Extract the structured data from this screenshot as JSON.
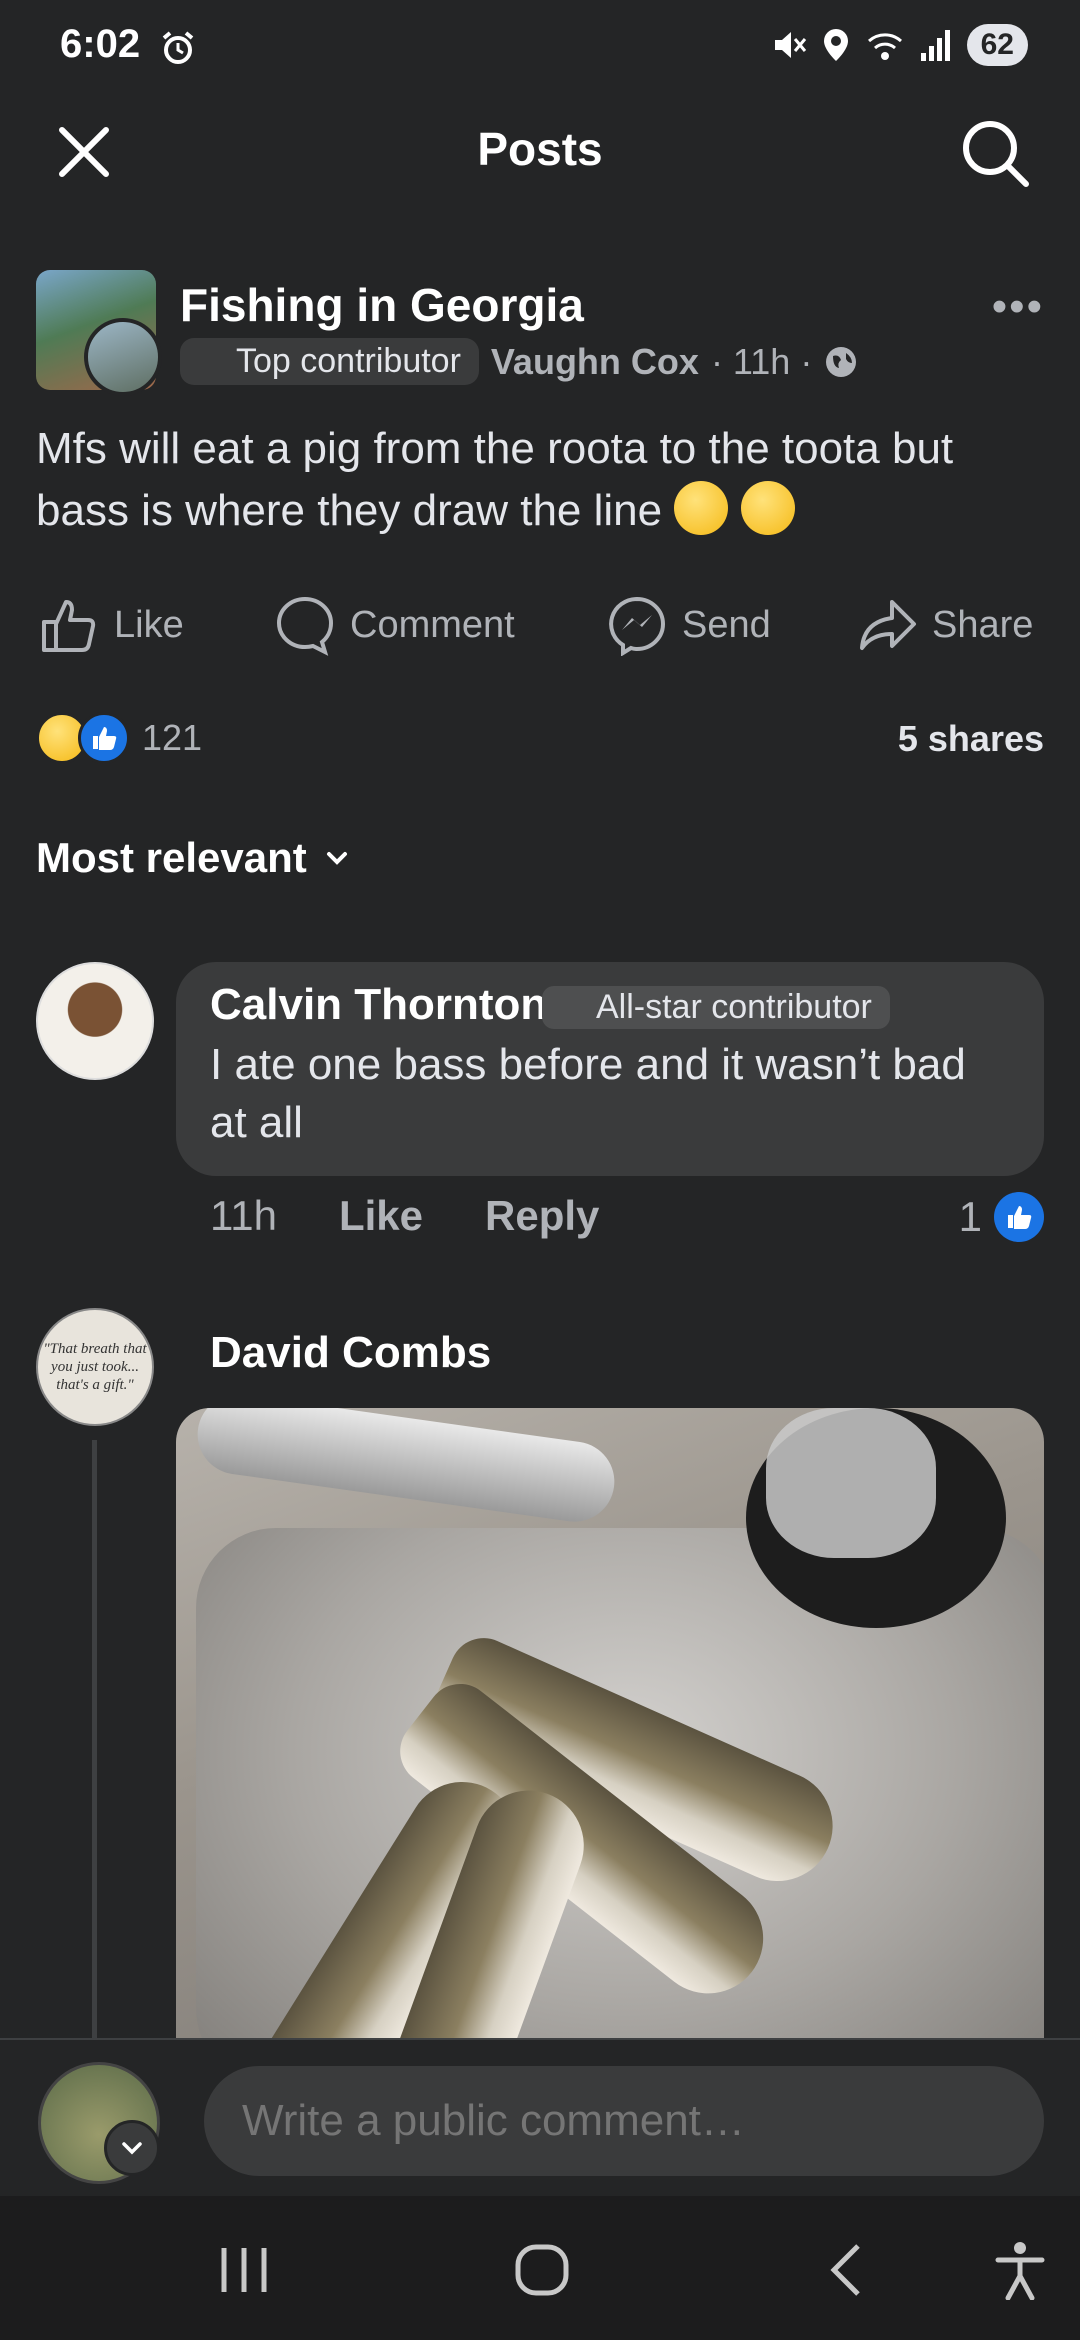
{
  "status_bar": {
    "time": "6:02",
    "battery": "62"
  },
  "header": {
    "title": "Posts"
  },
  "post": {
    "group_name": "Fishing in Georgia",
    "author_badge": "Top contributor",
    "author": "Vaughn Cox",
    "time": "· 11h ·",
    "text": "Mfs will eat a pig from the roota to the toota but bass is where they draw the line"
  },
  "actions": {
    "like": "Like",
    "comment": "Comment",
    "send": "Send",
    "share": "Share"
  },
  "reactions": {
    "count": "121",
    "shares": "5 shares"
  },
  "sort": {
    "label": "Most relevant"
  },
  "comments": [
    {
      "name": "Calvin Thornton",
      "badge": "All-star contributor",
      "text": "I ate one bass before and it wasn’t bad at all",
      "time": "11h",
      "like": "Like",
      "reply": "Reply",
      "likes": "1"
    },
    {
      "name": "David Combs",
      "avatar_quote": "\"That breath that you just took... that's a gift.\""
    }
  ],
  "composer": {
    "placeholder": "Write a public comment…"
  },
  "colors": {
    "background": "#242526",
    "bubble": "#3a3b3c",
    "accent": "#1b74e4",
    "secondary_text": "#b0b3b8"
  },
  "icons": [
    "alarm-icon",
    "mute-icon",
    "location-icon",
    "wifi-icon",
    "signal-icon",
    "close-icon",
    "search-icon",
    "globe-icon",
    "more-icon",
    "like-icon",
    "comment-icon",
    "messenger-icon",
    "share-icon",
    "chevron-down-icon",
    "recents-icon",
    "home-icon",
    "back-icon",
    "accessibility-icon"
  ]
}
